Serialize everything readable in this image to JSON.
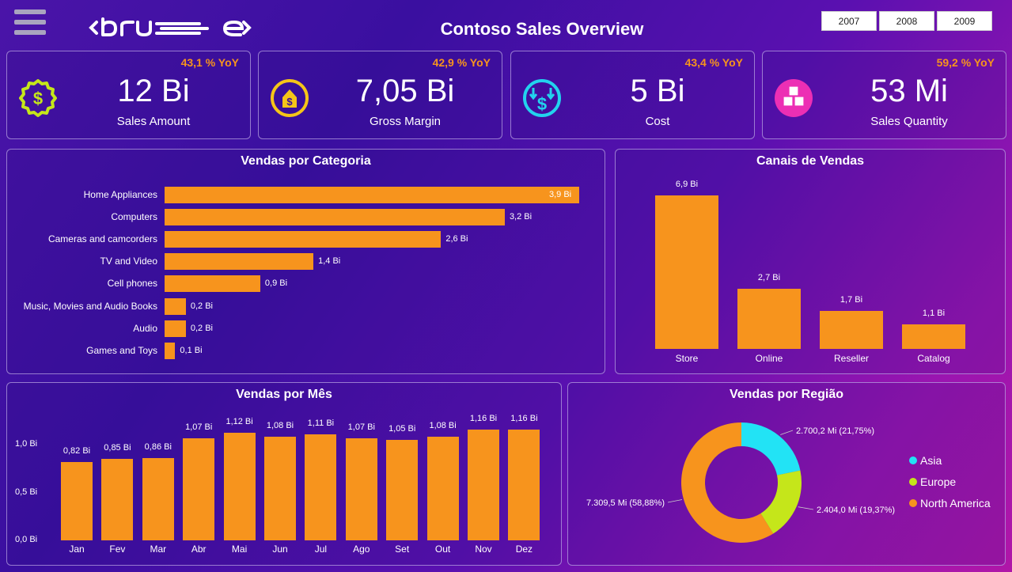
{
  "header": {
    "logo_text": "<bru e>",
    "title": "Contoso Sales Overview",
    "years": [
      "2007",
      "2008",
      "2009"
    ]
  },
  "kpis": [
    {
      "value": "12 Bi",
      "label": "Sales Amount",
      "yoy": "43,1 % YoY",
      "icon": "dollar-coin-icon",
      "color": "#c5e61a"
    },
    {
      "value": "7,05 Bi",
      "label": "Gross Margin",
      "yoy": "42,9 % YoY",
      "icon": "money-bag-icon",
      "color": "#f5c518"
    },
    {
      "value": "5 Bi",
      "label": "Cost",
      "yoy": "43,4 % YoY",
      "icon": "cost-arrows-icon",
      "color": "#22d3ee"
    },
    {
      "value": "53 Mi",
      "label": "Sales Quantity",
      "yoy": "59,2 % YoY",
      "icon": "cubes-icon",
      "color": "#ec2fb4"
    }
  ],
  "categoria": {
    "title": "Vendas por Categoria",
    "chart_data": {
      "type": "bar",
      "orientation": "horizontal",
      "categories": [
        "Home Appliances",
        "Computers",
        "Cameras and camcorders",
        "TV and Video",
        "Cell phones",
        "Music, Movies and Audio Books",
        "Audio",
        "Games and Toys"
      ],
      "values": [
        3.9,
        3.2,
        2.6,
        1.4,
        0.9,
        0.2,
        0.2,
        0.1
      ],
      "labels": [
        "3,9 Bi",
        "3,2 Bi",
        "2,6 Bi",
        "1,4 Bi",
        "0,9 Bi",
        "0,2 Bi",
        "0,2 Bi",
        "0,1 Bi"
      ],
      "xlim": [
        0,
        3.9
      ],
      "color": "#f7941d"
    }
  },
  "canais": {
    "title": "Canais de Vendas",
    "chart_data": {
      "type": "bar",
      "categories": [
        "Store",
        "Online",
        "Reseller",
        "Catalog"
      ],
      "values": [
        6.9,
        2.7,
        1.7,
        1.1
      ],
      "labels": [
        "6,9 Bi",
        "2,7 Bi",
        "1,7 Bi",
        "1,1 Bi"
      ],
      "ylim": [
        0,
        6.9
      ],
      "color": "#f7941d"
    }
  },
  "mes": {
    "title": "Vendas por Mês",
    "chart_data": {
      "type": "bar",
      "categories": [
        "Jan",
        "Fev",
        "Mar",
        "Abr",
        "Mai",
        "Jun",
        "Jul",
        "Ago",
        "Set",
        "Out",
        "Nov",
        "Dez"
      ],
      "values": [
        0.82,
        0.85,
        0.86,
        1.07,
        1.12,
        1.08,
        1.11,
        1.07,
        1.05,
        1.08,
        1.16,
        1.16
      ],
      "labels": [
        "0,82 Bi",
        "0,85 Bi",
        "0,86 Bi",
        "1,07 Bi",
        "1,12 Bi",
        "1,08 Bi",
        "1,11 Bi",
        "1,07 Bi",
        "1,05 Bi",
        "1,08 Bi",
        "1,16 Bi",
        "1,16 Bi"
      ],
      "yticks": [
        "0,0 Bi",
        "0,5 Bi",
        "1,0 Bi"
      ],
      "ytick_values": [
        0,
        0.5,
        1.0
      ],
      "ylim": [
        0,
        1.2
      ],
      "color": "#f7941d"
    }
  },
  "regiao": {
    "title": "Vendas por Região",
    "chart_data": {
      "type": "pie",
      "donut": true,
      "categories": [
        "Asia",
        "Europe",
        "North America"
      ],
      "values": [
        2700.2,
        2404.0,
        7309.5
      ],
      "labels": [
        "2.700,2 Mi (21,75%)",
        "2.404,0 Mi (19,37%)",
        "7.309,5 Mi (58,88%)"
      ],
      "colors": [
        "#22e3f5",
        "#c5e61a",
        "#f7941d"
      ],
      "legend_position": "right"
    }
  }
}
